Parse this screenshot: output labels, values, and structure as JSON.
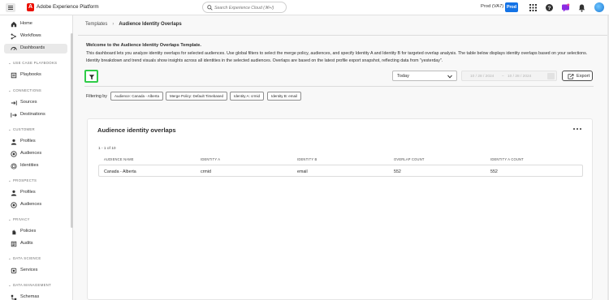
{
  "header": {
    "app_title": "Adobe Experience Platform",
    "search_placeholder": "Search Experience Cloud (⌘+/)",
    "org_name": "Prod (VA7)",
    "sandbox_badge": "Prod",
    "badge_color": "#1473e6",
    "icons": [
      "apps-grid-icon",
      "help-icon",
      "notifications-bell-icon",
      "announcements-icon"
    ]
  },
  "sidebar": {
    "items": [
      {
        "label": "Home",
        "icon": "home-icon"
      },
      {
        "label": "Workflows",
        "icon": "workflows-icon"
      },
      {
        "label": "Dashboards",
        "icon": "dashboard-icon",
        "active": true
      }
    ],
    "sections": [
      {
        "title": "USE CASE PLAYBOOKS",
        "items": [
          {
            "label": "Playbooks",
            "icon": "playbook-icon"
          }
        ]
      },
      {
        "title": "CONNECTIONS",
        "items": [
          {
            "label": "Sources",
            "icon": "sources-icon"
          },
          {
            "label": "Destinations",
            "icon": "destinations-icon"
          }
        ]
      },
      {
        "title": "CUSTOMER",
        "items": [
          {
            "label": "Profiles",
            "icon": "profile-icon"
          },
          {
            "label": "Audiences",
            "icon": "audiences-icon"
          },
          {
            "label": "Identities",
            "icon": "identities-icon"
          }
        ]
      },
      {
        "title": "PROSPECTS",
        "items": [
          {
            "label": "Profiles",
            "icon": "profile-icon"
          },
          {
            "label": "Audiences",
            "icon": "audiences-icon"
          }
        ]
      },
      {
        "title": "PRIVACY",
        "items": [
          {
            "label": "Policies",
            "icon": "policies-icon"
          },
          {
            "label": "Audits",
            "icon": "audits-icon"
          }
        ]
      },
      {
        "title": "DATA SCIENCE",
        "items": [
          {
            "label": "Services",
            "icon": "services-icon"
          }
        ]
      },
      {
        "title": "DATA MANAGEMENT",
        "items": [
          {
            "label": "Schemas",
            "icon": "schemas-icon"
          }
        ]
      }
    ]
  },
  "breadcrumb": {
    "parent": "Templates",
    "separator": "›",
    "current": "Audience Identity Overlaps"
  },
  "welcome": {
    "title": "Welcome to the Audience Identity Overlaps Template.",
    "body": "This dashboard lets you analyze identity overlaps for selected audiences. Use global filters to select the merge policy, audiences, and specify Identity A and Identity B for targeted overlap analysis. The table below displays identity overlaps based on your selections. Identity breakdown and trend visuals show insights across all identities in the selected audiences. Overlaps are based on the latest profile export snapshot, reflecting data from \"yesterday\"."
  },
  "toolbar": {
    "filter_icon": "filter-icon",
    "date_preset": "Today",
    "date_start": "10 / 28 / 2024",
    "date_sep": "–",
    "date_end": "10 / 28 / 2024",
    "export_label": "Export",
    "highlight_color": "#2fcc48"
  },
  "filters": {
    "label": "Filtering by",
    "chips": [
      "Audience: Canada - Alberta",
      "Merge Policy: Default Timebased",
      "Identity A: crmid",
      "Identity B: email"
    ]
  },
  "card": {
    "title": "Audience identity overlaps",
    "count_text": "1 - 1 of 10",
    "columns": [
      "AUDIENCE NAME",
      "IDENTITY A",
      "IDENTITY B",
      "OVERLAP COUNT",
      "IDENTITY A COUNT"
    ],
    "rows": [
      [
        "Canada - Alberta",
        "crmid",
        "email",
        "552",
        "552"
      ]
    ]
  }
}
